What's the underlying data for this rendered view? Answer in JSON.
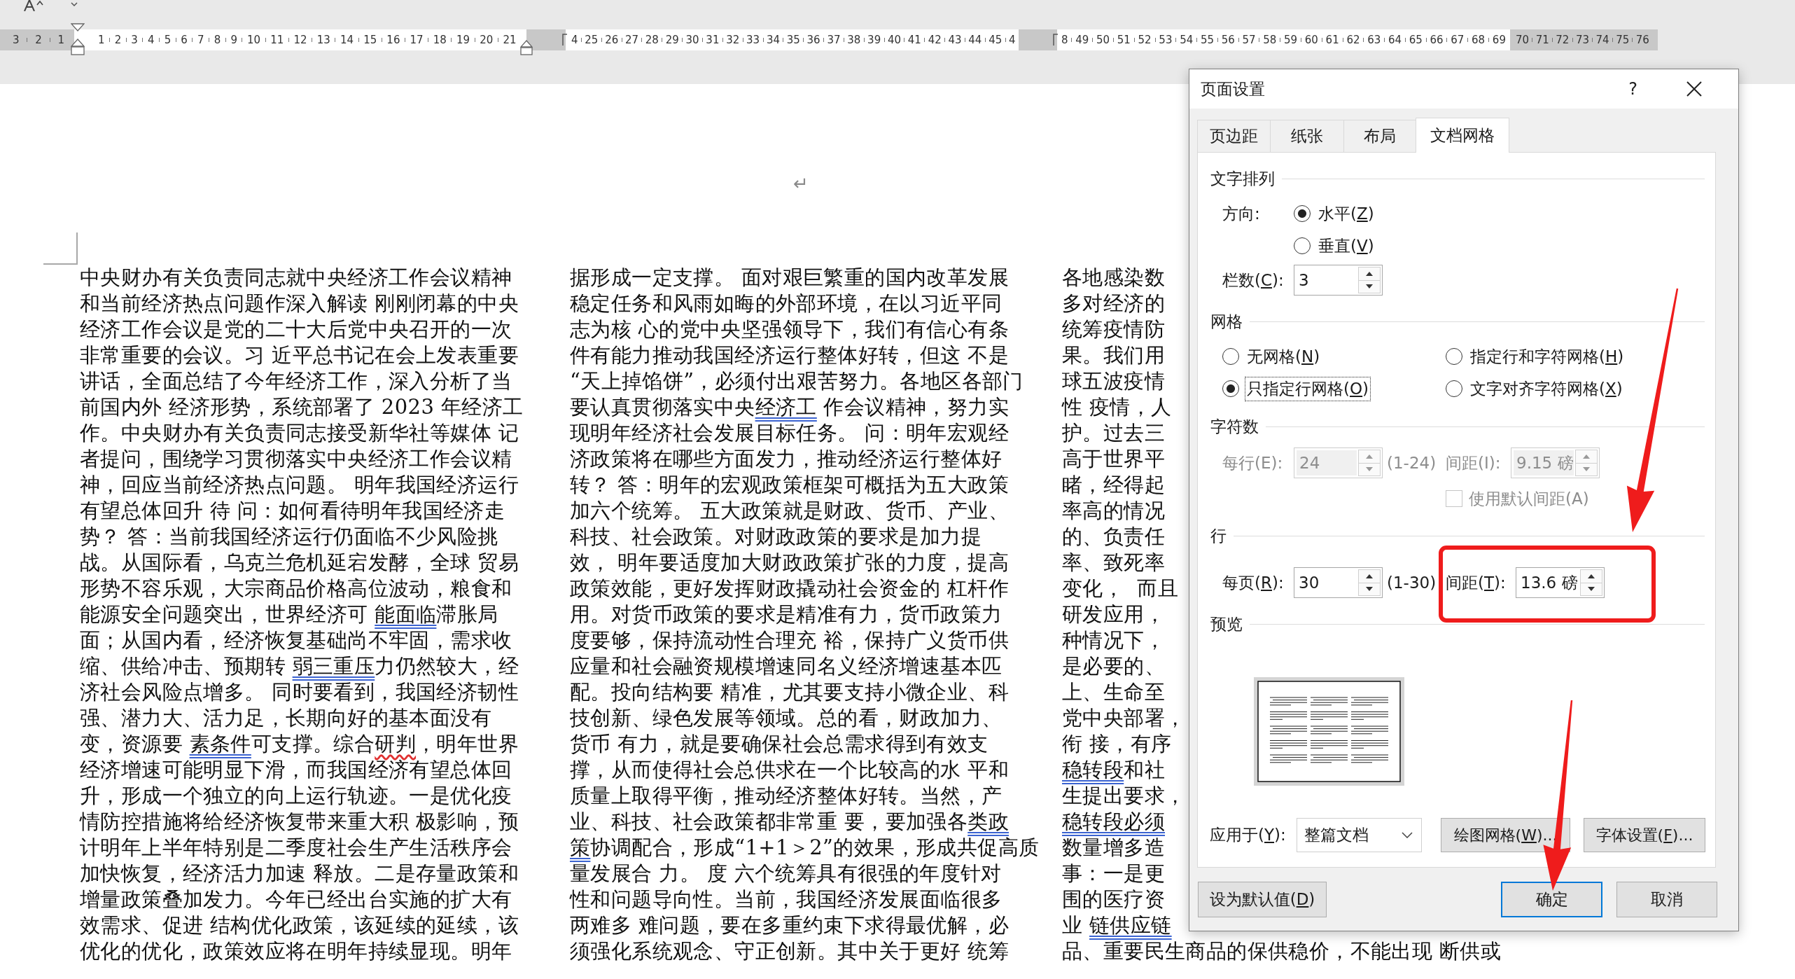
{
  "ruler": {
    "segments": [
      {
        "kind": "margin",
        "labels": [
          "3",
          "2",
          "1"
        ]
      },
      {
        "kind": "column",
        "labels": [
          "1",
          "2",
          "3",
          "4",
          "5",
          "6",
          "7",
          "8",
          "9",
          "10",
          "11",
          "12",
          "13",
          "14",
          "15",
          "16",
          "17",
          "18",
          "19",
          "20",
          "21"
        ]
      },
      {
        "kind": "gap"
      },
      {
        "kind": "column",
        "labels": [
          "4",
          "25",
          "26",
          "27",
          "28",
          "29",
          "30",
          "31",
          "32",
          "33",
          "34",
          "35",
          "36",
          "37",
          "38",
          "39",
          "40",
          "41",
          "42",
          "43",
          "44",
          "45",
          "4"
        ]
      },
      {
        "kind": "gap"
      },
      {
        "kind": "column",
        "labels": [
          "8",
          "49",
          "50",
          "51",
          "52",
          "53",
          "54",
          "55",
          "56",
          "57",
          "58",
          "59",
          "60",
          "61",
          "62",
          "63",
          "64",
          "65",
          "66",
          "67",
          "68",
          "69"
        ]
      },
      {
        "kind": "margin",
        "labels": [
          "70",
          "71",
          "72",
          "73",
          "74",
          "75",
          "76"
        ]
      }
    ]
  },
  "document": {
    "paragraph_mark": "↵",
    "columns": [
      {
        "lines": [
          "中央财办有关负责同志就中央经济工作会议精神",
          "和当前经济热点问题作深入解读 刚刚闭幕的中央",
          "经济工作会议是党的二十大后党中央召开的一次",
          "非常重要的会议。习 近平总书记在会上发表重要",
          "讲话，全面总结了今年经济工作，深入分析了当",
          "前国内外 经济形势，系统部署了 2023 年经济工",
          "作。中央财办有关负责同志接受新华社等媒体 记",
          "者提问，围绕学习贯彻落实中央经济工作会议精",
          "神，回应当前经济热点问题。 明年我国经济运行",
          "有望总体回升 待 问：如何看待明年我国经济走",
          "势？ 答：当前我国经济运行仍面临不少风险挑",
          "战。从国际看，乌克兰危机延宕发酵，全球 贸易",
          "形势不容乐观，大宗商品价格高位波动，粮食和",
          {
            "parts": [
              {
                "text": "能源安全问题突出，世界经济可 ",
                "grammar_mark": false,
                "spelling_mark": false
              },
              {
                "text": "能面临",
                "grammar_mark": true,
                "spelling_mark": false
              },
              {
                "text": "滞胀局",
                "grammar_mark": false,
                "spelling_mark": false
              }
            ]
          },
          "面；从国内看，经济恢复基础尚不牢固，需求收",
          {
            "parts": [
              {
                "text": "缩、供给冲击、预期转 ",
                "grammar_mark": false,
                "spelling_mark": false
              },
              {
                "text": "弱三重压",
                "grammar_mark": true,
                "spelling_mark": false
              },
              {
                "text": "力仍然较大，经",
                "grammar_mark": false,
                "spelling_mark": false
              }
            ]
          },
          "济社会风险点增多。 同时要看到，我国经济韧性",
          "强、潜力大、活力足，长期向好的基本面没有",
          {
            "parts": [
              {
                "text": "变，资源要 ",
                "grammar_mark": false,
                "spelling_mark": false
              },
              {
                "text": "素条件",
                "grammar_mark": true,
                "spelling_mark": false
              },
              {
                "text": "可支撑。综合",
                "grammar_mark": false,
                "spelling_mark": false
              },
              {
                "text": "研判",
                "grammar_mark": false,
                "spelling_mark": true
              },
              {
                "text": "，明年世界",
                "grammar_mark": false,
                "spelling_mark": false
              }
            ]
          },
          "经济增速可能明显下滑，而我国经济有望总体回",
          "升，形成一个独立的向上运行轨迹。一是优化疫",
          "情防控措施将给经济恢复带来重大积 极影响，预",
          "计明年上半年特别是二季度社会生产生活秩序会",
          "加快恢复，经济活力加速 释放。二是存量政策和",
          "增量政策叠加发力。今年已经出台实施的扩大有",
          "效需求、促进 结构优化政策，该延续的延续，该",
          "优化的优化，政策效应将在明年持续显现。明年"
        ]
      },
      {
        "lines": [
          "据形成一定支撑。 面对艰巨繁重的国内改革发展",
          "稳定任务和风雨如晦的外部环境，在以习近平同",
          "志为核 心的党中央坚强领导下，我们有信心有条",
          "件有能力推动我国经济运行整体好转，但这 不是",
          "“天上掉馅饼”，必须付出艰苦努力。各地区各部门",
          {
            "parts": [
              {
                "text": "要认真贯彻落实中央",
                "grammar_mark": false,
                "spelling_mark": false
              },
              {
                "text": "经济工",
                "grammar_mark": true,
                "spelling_mark": false
              },
              {
                "text": " 作会议精神，努力实",
                "grammar_mark": false,
                "spelling_mark": false
              }
            ]
          },
          "现明年经济社会发展目标任务。 问：明年宏观经",
          "济政策将在哪些方面发力，推动经济运行整体好",
          "转？ 答：明年的宏观政策框架可概括为五大政策",
          "加六个统筹。 五大政策就是财政、货币、产业、",
          "科技、社会政策。对财政政策的要求是加力提",
          "效， 明年要适度加大财政政策扩张的力度，提高",
          "政策效能，更好发挥财政撬动社会资金的 杠杆作",
          "用。对货币政策的要求是精准有力，货币政策力",
          "度要够，保持流动性合理充 裕，保持广义货币供",
          "应量和社会融资规模增速同名义经济增速基本匹",
          "配。投向结构要 精准，尤其要支持小微企业、科",
          "技创新、绿色发展等领域。总的看，财政加力、",
          "货币 有力，就是要确保社会总需求得到有效支",
          "撑，从而使得社会总供求在一个比较高的水 平和",
          "质量上取得平衡，推动经济整体好转。当然，产",
          {
            "parts": [
              {
                "text": "业、科技、社会政策都非常重 要，要加强各",
                "grammar_mark": false,
                "spelling_mark": false
              },
              {
                "text": "类政",
                "grammar_mark": true,
                "spelling_mark": false
              }
            ]
          },
          {
            "parts": [
              {
                "text": "策",
                "grammar_mark": true,
                "spelling_mark": false
              },
              {
                "text": "协调配合，形成“1+1＞2”的效果，形成共促高质",
                "grammar_mark": false,
                "spelling_mark": false
              }
            ]
          },
          "量发展合 力。 度 六个统筹具有很强的年度针对",
          "性和问题导向性。当前，我国经济发展面临很多",
          "两难多 难问题，要在多重约束下求得最优解，必",
          "须强化系统观念、守正创新。其中关于更好 统筹"
        ]
      },
      {
        "lines": [
          "各地感染数",
          "多对经济的",
          "统筹疫情防",
          "果。我们用",
          "球五波疫情",
          "性 疫情，人",
          "护。过去三",
          "高于世界平",
          "睹，经得起",
          "率高的情况",
          "的、负责任",
          "率、致死率",
          "变化，  而且",
          "研发应用，",
          "种情况下，",
          "是必要的、",
          "上、生命至",
          "党中央部署，",
          "衔 接，有序",
          {
            "parts": [
              {
                "text": "稳转段",
                "grammar_mark": true,
                "spelling_mark": false
              },
              {
                "text": "和社",
                "grammar_mark": false,
                "spelling_mark": false
              }
            ]
          },
          "生提出要求，",
          {
            "parts": [
              {
                "text": "稳转段必须",
                "grammar_mark": true,
                "spelling_mark": false
              }
            ]
          },
          "数量增多造",
          "事：一是更",
          "围的医疗资",
          {
            "parts": [
              {
                "text": "业 ",
                "grammar_mark": false,
                "spelling_mark": false
              },
              {
                "text": "链供应链",
                "grammar_mark": true,
                "spelling_mark": false
              }
            ]
          },
          "品、重要民生商品的保供稳价，不能出现 断供或"
        ]
      }
    ]
  },
  "dialog": {
    "title": "页面设置",
    "help": "?",
    "tabs": [
      {
        "label": "页边距",
        "selected": false
      },
      {
        "label": "纸张",
        "selected": false
      },
      {
        "label": "布局",
        "selected": false
      },
      {
        "label": "文档网格",
        "selected": true
      }
    ],
    "text_layout": {
      "heading": "文字排列",
      "direction_label": "方向:",
      "directions": [
        {
          "label": [
            "水平(",
            "Z",
            ")"
          ],
          "selected": true
        },
        {
          "label": [
            "垂直(",
            "V",
            ")"
          ],
          "selected": false
        }
      ],
      "columns": {
        "label": [
          "栏数(",
          "C",
          "):"
        ],
        "value": "3",
        "disabled": false
      }
    },
    "grid": {
      "heading": "网格",
      "options": [
        {
          "label": [
            "无网格(",
            "N",
            ")"
          ],
          "selected": false,
          "focused": false
        },
        {
          "label": [
            "指定行和字符网格(",
            "H",
            ")"
          ],
          "selected": false,
          "focused": false
        },
        {
          "label": [
            "只指定行网格(",
            "O",
            ")"
          ],
          "selected": true,
          "focused": true
        },
        {
          "label": [
            "文字对齐字符网格(",
            "X",
            ")"
          ],
          "selected": false,
          "focused": false
        }
      ]
    },
    "characters": {
      "heading": "字符数",
      "per_line": {
        "label": "每行(E):",
        "value": "24",
        "range": "(1-24)",
        "disabled": true
      },
      "pitch": {
        "label": "间距(I):",
        "value": "9.15 磅",
        "disabled": true
      },
      "default_pitch": {
        "label": "使用默认间距(A)",
        "checked": false,
        "disabled": true
      }
    },
    "lines": {
      "heading": "行",
      "per_page": {
        "label": [
          "每页(",
          "R",
          "):"
        ],
        "value": "30",
        "range": "(1-30)",
        "disabled": false
      },
      "pitch": {
        "label": [
          "间距(",
          "T",
          "):"
        ],
        "value": "13.6 磅",
        "disabled": false
      }
    },
    "preview": {
      "heading": "预览"
    },
    "apply": {
      "label": [
        "应用于(",
        "Y",
        "):"
      ],
      "value": "整篇文档",
      "buttons": [
        [
          "绘图网格(",
          "W",
          ")..."
        ],
        [
          "字体设置(",
          "F",
          ")..."
        ]
      ]
    },
    "footer": [
      {
        "label": [
          "设为默认值(",
          "D",
          ")"
        ],
        "default": false
      },
      {
        "label": "确定",
        "default": true
      },
      {
        "label": "取消",
        "default": false
      }
    ]
  },
  "annotations": [
    {
      "kind": "frame"
    },
    {
      "kind": "arrow"
    },
    {
      "kind": "arrow"
    }
  ]
}
